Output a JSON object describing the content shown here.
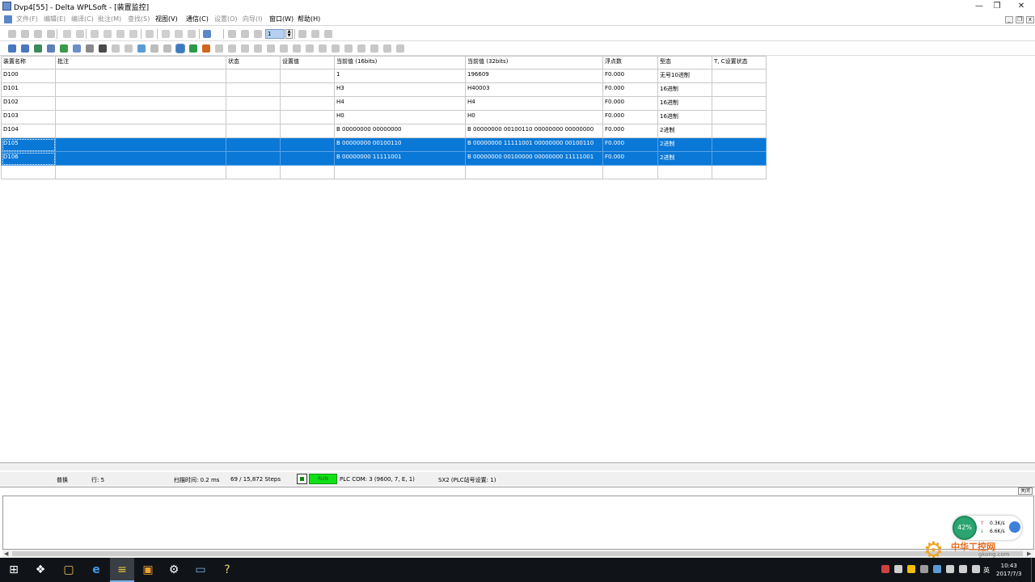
{
  "window": {
    "title": "Dvp4[55] - Delta WPLSoft - [装置监控]"
  },
  "menu": [
    {
      "label": "文件(F)",
      "enabled": false
    },
    {
      "label": "编辑(E)",
      "enabled": false
    },
    {
      "label": "编译(C)",
      "enabled": false
    },
    {
      "label": "批注(M)",
      "enabled": false
    },
    {
      "label": "查找(S)",
      "enabled": false
    },
    {
      "label": "视图(V)",
      "enabled": true
    },
    {
      "label": "通信(C)",
      "enabled": true
    },
    {
      "label": "设置(O)",
      "enabled": false
    },
    {
      "label": "向导(I)",
      "enabled": false
    },
    {
      "label": "窗口(W)",
      "enabled": true
    },
    {
      "label": "帮助(H)",
      "enabled": true
    }
  ],
  "toolbar": {
    "step_value": "1"
  },
  "table": {
    "columns": [
      "装置名称",
      "批注",
      "状态",
      "设置值",
      "当前值 (16bits)",
      "当前值 (32bits)",
      "浮点数",
      "型态",
      "T, C设置状态"
    ],
    "rows": [
      {
        "device": "D100",
        "comment": "",
        "status": "",
        "setting": "",
        "v16": "1",
        "v32": "196609",
        "float": "F0.000",
        "type": "无号10进制",
        "tc": "",
        "selected": false
      },
      {
        "device": "D101",
        "comment": "",
        "status": "",
        "setting": "",
        "v16": "H3",
        "v32": "H40003",
        "float": "F0.000",
        "type": "16进制",
        "tc": "",
        "selected": false
      },
      {
        "device": "D102",
        "comment": "",
        "status": "",
        "setting": "",
        "v16": "H4",
        "v32": "H4",
        "float": "F0.000",
        "type": "16进制",
        "tc": "",
        "selected": false
      },
      {
        "device": "D103",
        "comment": "",
        "status": "",
        "setting": "",
        "v16": "H0",
        "v32": "H0",
        "float": "F0.000",
        "type": "16进制",
        "tc": "",
        "selected": false
      },
      {
        "device": "D104",
        "comment": "",
        "status": "",
        "setting": "",
        "v16": "B 00000000 00000000",
        "v32": "B 00000000 00100110 00000000 00000000",
        "float": "F0.000",
        "type": "2进制",
        "tc": "",
        "selected": false
      },
      {
        "device": "D105",
        "comment": "",
        "status": "",
        "setting": "",
        "v16": "B 00000000 00100110",
        "v32": "B 00000000 11111001 00000000 00100110",
        "float": "F0.000",
        "type": "2进制",
        "tc": "",
        "selected": true
      },
      {
        "device": "D106",
        "comment": "",
        "status": "",
        "setting": "",
        "v16": "B 00000000 11111001",
        "v32": "B 00000000 00100000 00000000 11111001",
        "float": "F0.000",
        "type": "2进制",
        "tc": "",
        "selected": true
      },
      {
        "device": "",
        "comment": "",
        "status": "",
        "setting": "",
        "v16": "",
        "v32": "",
        "float": "",
        "type": "",
        "tc": "",
        "selected": false
      }
    ]
  },
  "status": {
    "mode": "普换",
    "row": "行: 5",
    "scan_time": "扫描时间: 0.2 ms",
    "steps": "69 / 15,872 Steps",
    "run": "RUN",
    "com": "PLC COM: 3 (9600, 7, E, 1)",
    "station": "SX2 (PLC站号设置: 1)"
  },
  "panel_close": "关闭",
  "netmon": {
    "cpu": "42%",
    "up": "0.3K/s",
    "down": "6.6K/s"
  },
  "watermark": {
    "text": "中华工控网",
    "sub": "gkong.com"
  },
  "taskbar": {
    "time": "10:43",
    "date": "2017/7/3",
    "ime": "英"
  },
  "colors": {
    "selection": "#0a78d7",
    "run_led": "#11e016",
    "taskbar": "#101418"
  }
}
